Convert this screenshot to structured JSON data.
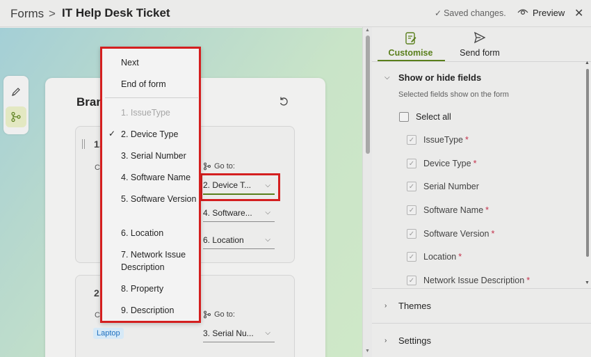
{
  "header": {
    "breadcrumb_root": "Forms",
    "breadcrumb_sep": ">",
    "title": "IT Help Desk Ticket",
    "saved_status": "Saved changes.",
    "preview_label": "Preview",
    "close_glyph": "✕"
  },
  "canvas": {
    "card_title": "Bran",
    "question1": {
      "number": "1.",
      "cut_text": "C",
      "goto_label": "Go to:",
      "goto_selects": [
        "2. Device T...",
        "4. Software...",
        "6. Location"
      ]
    },
    "question2": {
      "number": "2",
      "cut_text": "C",
      "tag": "Laptop",
      "goto_label": "Go to:",
      "goto_select": "3. Serial Nu..."
    }
  },
  "dropdown": {
    "items": [
      {
        "label": "Next",
        "disabled": false,
        "checked": false
      },
      {
        "label": "End of form",
        "disabled": false,
        "checked": false
      },
      {
        "label": "1. IssueType",
        "disabled": true,
        "checked": false
      },
      {
        "label": "2. Device Type",
        "disabled": false,
        "checked": true
      },
      {
        "label": "3. Serial Number",
        "disabled": false,
        "checked": false
      },
      {
        "label": "4. Software Name",
        "disabled": false,
        "checked": false
      },
      {
        "label": "5. Software Version",
        "disabled": false,
        "checked": false
      },
      {
        "label": "6. Location",
        "disabled": false,
        "checked": false
      },
      {
        "label": "7. Network Issue Description",
        "disabled": false,
        "checked": false
      },
      {
        "label": "8. Property",
        "disabled": false,
        "checked": false
      },
      {
        "label": "9. Description",
        "disabled": false,
        "checked": false
      }
    ],
    "check_glyph": "✓"
  },
  "panel": {
    "tabs": [
      {
        "label": "Customise",
        "active": true
      },
      {
        "label": "Send form",
        "active": false
      }
    ],
    "show_hide": {
      "title": "Show or hide fields",
      "hint": "Selected fields show on the form",
      "select_all": "Select all",
      "fields": [
        {
          "label": "IssueType",
          "required": true
        },
        {
          "label": "Device Type",
          "required": true
        },
        {
          "label": "Serial Number",
          "required": false
        },
        {
          "label": "Software Name",
          "required": true
        },
        {
          "label": "Software Version",
          "required": true
        },
        {
          "label": "Location",
          "required": true
        },
        {
          "label": "Network Issue Description",
          "required": true
        }
      ]
    },
    "themes_label": "Themes",
    "settings_label": "Settings",
    "required_marker": "*"
  },
  "colors": {
    "accent": "#5a7f1c",
    "highlight": "#d41f1f",
    "required": "#c4314b"
  }
}
